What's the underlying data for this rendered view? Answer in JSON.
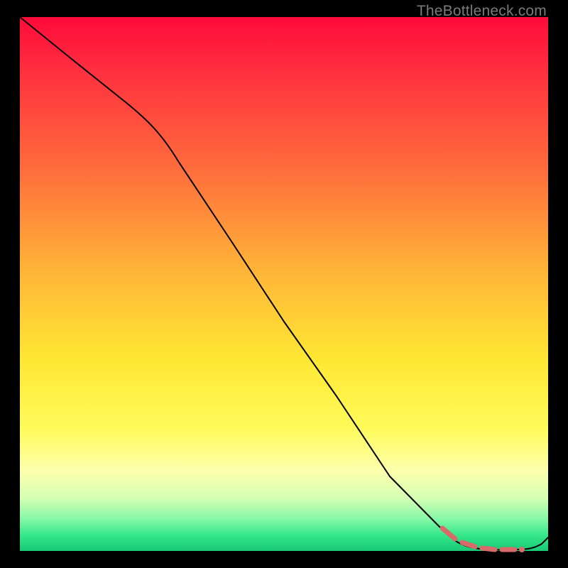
{
  "watermark": "TheBottleneck.com",
  "colors": {
    "background": "#000000",
    "line": "#000000",
    "accent_dash": "#d96a6a",
    "gradient_top": "#ff0a3a",
    "gradient_bottom": "#18c877"
  },
  "chart_data": {
    "type": "line",
    "title": "",
    "xlabel": "",
    "ylabel": "",
    "xlim": [
      0,
      100
    ],
    "ylim": [
      0,
      100
    ],
    "series": [
      {
        "name": "curve",
        "x": [
          0,
          10,
          20,
          26,
          30,
          40,
          50,
          60,
          70,
          80,
          84,
          86,
          88,
          90,
          92,
          94,
          96,
          98,
          100
        ],
        "y": [
          100,
          92,
          84,
          79,
          73,
          58,
          43,
          29,
          14,
          4,
          2,
          1,
          0.6,
          0.3,
          0.2,
          0.2,
          0.3,
          0.8,
          2.5
        ]
      }
    ],
    "highlight": {
      "name": "selected-range",
      "style": "dashed",
      "x": [
        80,
        82,
        84,
        86,
        88,
        90,
        92,
        94,
        95
      ],
      "y": [
        4.3,
        3.0,
        2.0,
        1.2,
        0.7,
        0.4,
        0.3,
        0.3,
        0.3
      ]
    },
    "marker": {
      "x": 95,
      "y": 0.3
    }
  }
}
